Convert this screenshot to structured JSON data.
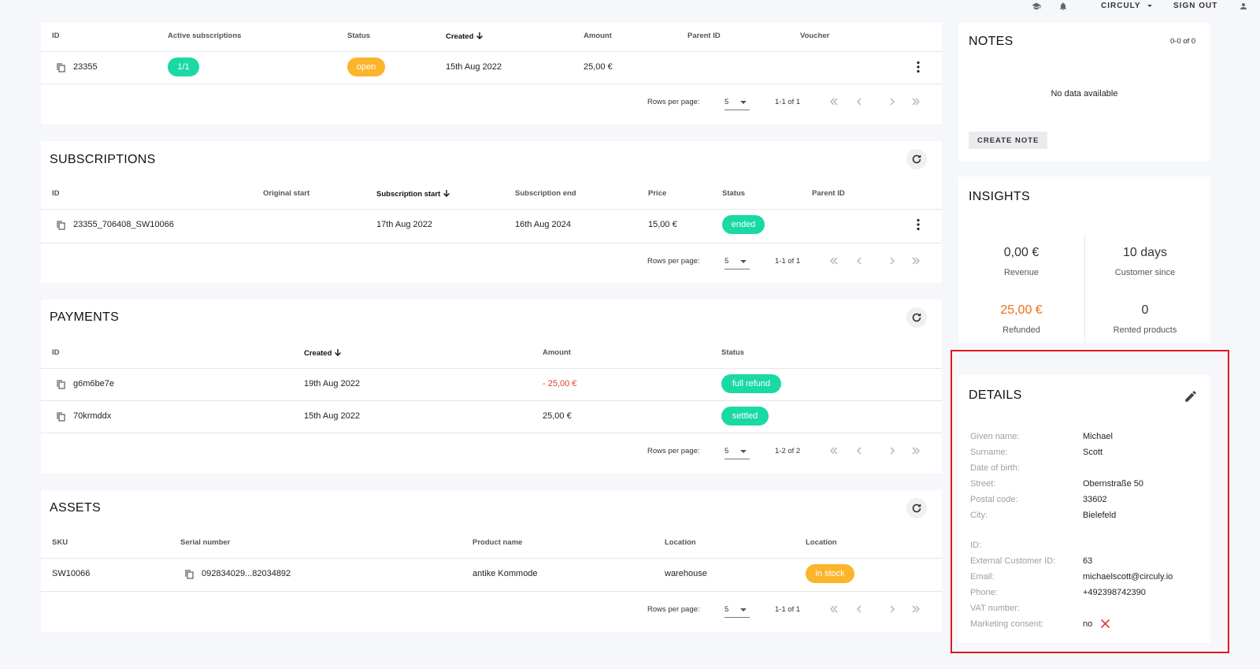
{
  "topbar": {
    "org_label": "CIRCULY",
    "signout_label": "SIGN OUT"
  },
  "orders": {
    "headers": [
      "ID",
      "Active subscriptions",
      "Status",
      "Created",
      "Amount",
      "Parent ID",
      "Voucher"
    ],
    "row": {
      "id": "23355",
      "active_subs": "1/1",
      "status": "open",
      "created": "15th Aug 2022",
      "amount": "25,00 €",
      "parent_id": "",
      "voucher": ""
    },
    "pager": {
      "rows_label": "Rows per page:",
      "rows_value": "5",
      "range": "1-1 of 1"
    }
  },
  "subscriptions": {
    "title": "SUBSCRIPTIONS",
    "headers": [
      "ID",
      "Original start",
      "Subscription start",
      "Subscription end",
      "Price",
      "Status",
      "Parent ID"
    ],
    "row": {
      "id": "23355_706408_SW10066",
      "original_start": "",
      "start": "17th Aug 2022",
      "end": "16th Aug 2024",
      "price": "15,00 €",
      "status": "ended",
      "parent_id": ""
    },
    "pager": {
      "rows_label": "Rows per page:",
      "rows_value": "5",
      "range": "1-1 of 1"
    }
  },
  "payments": {
    "title": "PAYMENTS",
    "headers": [
      "ID",
      "Created",
      "Amount",
      "Status"
    ],
    "rows": [
      {
        "id": "g6m6be7e",
        "created": "19th Aug 2022",
        "amount": "- 25,00 €",
        "status": "full refund"
      },
      {
        "id": "70krmddx",
        "created": "15th Aug 2022",
        "amount": "25,00 €",
        "status": "settled"
      }
    ],
    "pager": {
      "rows_label": "Rows per page:",
      "rows_value": "5",
      "range": "1-2 of 2"
    }
  },
  "assets": {
    "title": "ASSETS",
    "headers": [
      "SKU",
      "Serial number",
      "Product name",
      "Location",
      "Location"
    ],
    "row": {
      "sku": "SW10066",
      "serial": "092834029...82034892",
      "product": "antike Kommode",
      "location": "warehouse",
      "status": "in stock"
    },
    "pager": {
      "rows_label": "Rows per page:",
      "rows_value": "5",
      "range": "1-1 of 1"
    }
  },
  "notes": {
    "title": "NOTES",
    "count": "0-0 of 0",
    "empty": "No data available",
    "create_label": "CREATE NOTE"
  },
  "insights": {
    "title": "INSIGHTS",
    "items": [
      {
        "value": "0,00 €",
        "label": "Revenue"
      },
      {
        "value": "10 days",
        "label": "Customer since"
      },
      {
        "value": "25,00 €",
        "label": "Refunded"
      },
      {
        "value": "0",
        "label": "Rented products"
      }
    ]
  },
  "details": {
    "title": "DETAILS",
    "fields": [
      {
        "label": "Given name:",
        "value": "Michael"
      },
      {
        "label": "Surname:",
        "value": "Scott"
      },
      {
        "label": "Date of birth:",
        "value": ""
      },
      {
        "label": "Street:",
        "value": "Obernstraße 50"
      },
      {
        "label": "Postal code:",
        "value": "33602"
      },
      {
        "label": "City:",
        "value": "Bielefeld"
      },
      {
        "label": "ID:",
        "value": ""
      },
      {
        "label": "External Customer ID:",
        "value": "63"
      },
      {
        "label": "Email:",
        "value": "michaelscott@circuly.io"
      },
      {
        "label": "Phone:",
        "value": "+492398742390"
      },
      {
        "label": "VAT number:",
        "value": ""
      },
      {
        "label": "Marketing consent:",
        "value": "no"
      }
    ]
  },
  "colors": {
    "green": "#1ad9a4",
    "amber": "#fbb52b",
    "red": "#e53935",
    "orange": "#ec7014",
    "highlight": "#e0191d"
  }
}
